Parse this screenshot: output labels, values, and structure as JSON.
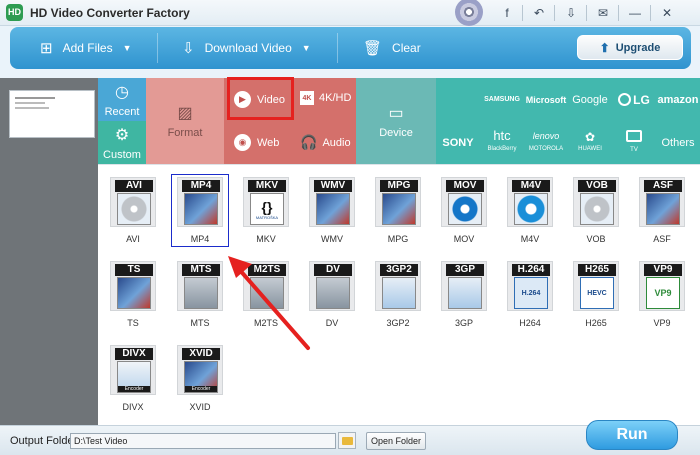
{
  "window": {
    "title": "HD Video Converter Factory",
    "logo_text": "HD"
  },
  "titlebar": {
    "buttons": [
      "f",
      "↶",
      "⇩",
      "✉",
      "—",
      "✕"
    ]
  },
  "toolbar": {
    "add_files": "Add Files",
    "download_video": "Download Video",
    "clear": "Clear",
    "upgrade": "Upgrade"
  },
  "categories": {
    "recent": "Recent",
    "custom": "Custom",
    "format": "Format",
    "video": "Video",
    "hd": "4K/HD",
    "web": "Web",
    "audio": "Audio",
    "device": "Device",
    "hd_badge": "4K"
  },
  "brands": [
    "",
    "SAMSUNG",
    "Microsoft",
    "Google",
    "LG",
    "amazon",
    "SONY",
    "htc",
    "lenovo",
    "HUAWEI",
    "TV",
    "Others"
  ],
  "brand_subtext": {
    "htc": "BlackBerry",
    "lenovo": "MOTOROLA",
    "lg_prefix": "LG"
  },
  "formats": [
    {
      "label": "AVI",
      "tag": "AVI"
    },
    {
      "label": "MP4",
      "tag": "MP4"
    },
    {
      "label": "MKV",
      "tag": "MKV"
    },
    {
      "label": "WMV",
      "tag": "WMV"
    },
    {
      "label": "MPG",
      "tag": "MPG"
    },
    {
      "label": "MOV",
      "tag": "MOV"
    },
    {
      "label": "M4V",
      "tag": "M4V"
    },
    {
      "label": "VOB",
      "tag": "VOB"
    },
    {
      "label": "ASF",
      "tag": "ASF"
    },
    {
      "label": "TS",
      "tag": "TS"
    },
    {
      "label": "MTS",
      "tag": "MTS"
    },
    {
      "label": "M2TS",
      "tag": "M2TS"
    },
    {
      "label": "DV",
      "tag": "DV"
    },
    {
      "label": "3GP2",
      "tag": "3GP2"
    },
    {
      "label": "3GP",
      "tag": "3GP"
    },
    {
      "label": "H264",
      "tag": "H.264"
    },
    {
      "label": "H265",
      "tag": "H265"
    },
    {
      "label": "VP9",
      "tag": "VP9"
    },
    {
      "label": "DIVX",
      "tag": "DIVX"
    },
    {
      "label": "XVID",
      "tag": "XVID"
    }
  ],
  "format_art_text": {
    "mkv": "MATROŠKA",
    "h264": "H.264",
    "h265": "HEVC",
    "vp9": "VP9",
    "encoder": "Encoder"
  },
  "selected_format": "MP4",
  "bottom": {
    "output_label": "Output Folder:",
    "output_value": "D:\\Test Video",
    "open_folder": "Open Folder",
    "run": "Run"
  },
  "colors": {
    "toolbar": "#3aa0d8",
    "recent": "#4aa7d6",
    "custom": "#3fb6a2",
    "video_group": "#d4706b",
    "format": "#e39a95",
    "device": "#6bb9b5",
    "brands": "#42b8ae",
    "highlight": "#e5211f"
  }
}
